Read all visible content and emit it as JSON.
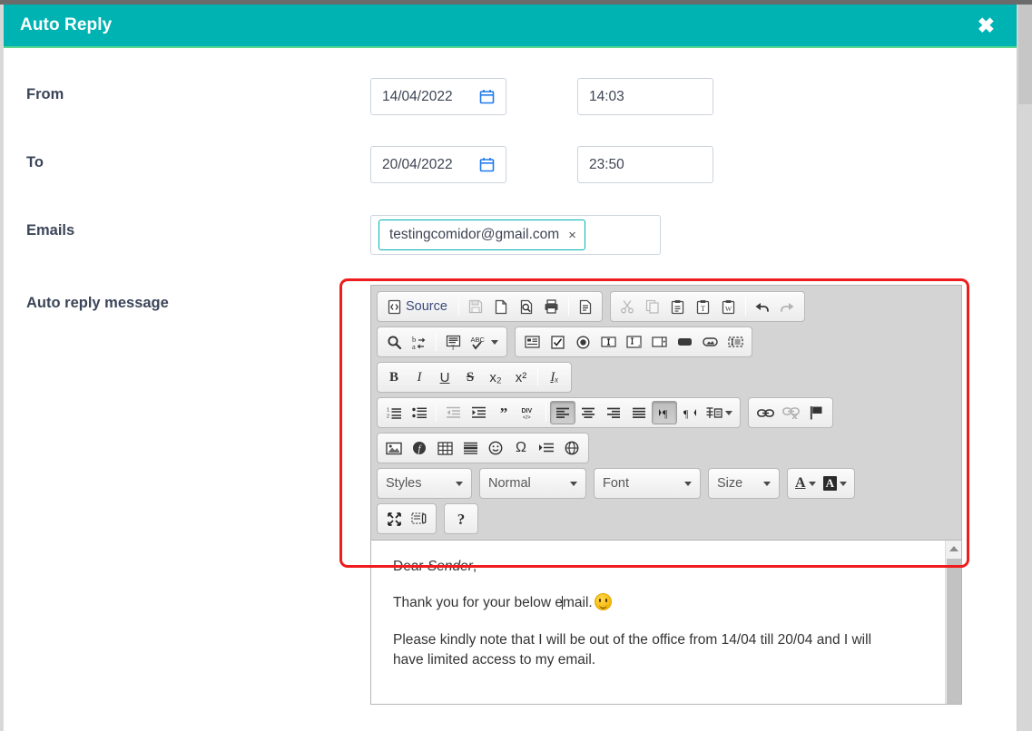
{
  "window": {
    "title": "Auto Reply",
    "close_label": "✖",
    "accent_color": "#00b3b3",
    "highlight_color": "#ee1c1c"
  },
  "form": {
    "rows": [
      {
        "label": "From",
        "date_value": "14/04/2022",
        "date_icon": "calendar-icon",
        "time_value": "14:03"
      },
      {
        "label": "To",
        "date_value": "20/04/2022",
        "date_icon": "calendar-icon",
        "time_value": "23:50"
      }
    ],
    "emails": {
      "label": "Emails",
      "chips": [
        {
          "text": "testingcomidor@gmail.com",
          "remove_label": "×"
        }
      ]
    },
    "message": {
      "label": "Auto reply message"
    }
  },
  "editor": {
    "toolbar": {
      "row1": [
        {
          "name": "source-button",
          "label": "Source",
          "icon": "source-icon",
          "state": "normal"
        },
        {
          "name": "separator",
          "icon": "separator",
          "state": "normal"
        },
        {
          "name": "save-button",
          "icon": "save-icon",
          "state": "disabled"
        },
        {
          "name": "new-page-button",
          "icon": "new-page-icon",
          "state": "normal"
        },
        {
          "name": "preview-button",
          "icon": "preview-icon",
          "state": "normal"
        },
        {
          "name": "print-button",
          "icon": "print-icon",
          "state": "normal"
        },
        {
          "name": "separator",
          "icon": "separator",
          "state": "normal"
        },
        {
          "name": "templates-button",
          "icon": "templates-icon",
          "state": "normal"
        }
      ],
      "row1b": [
        {
          "name": "cut-button",
          "icon": "scissors-icon",
          "state": "disabled"
        },
        {
          "name": "copy-button",
          "icon": "copy-icon",
          "state": "disabled"
        },
        {
          "name": "paste-button",
          "icon": "paste-icon",
          "state": "normal"
        },
        {
          "name": "paste-text-button",
          "icon": "paste-text-icon",
          "state": "normal"
        },
        {
          "name": "paste-word-button",
          "icon": "paste-word-icon",
          "state": "normal"
        },
        {
          "name": "separator",
          "icon": "separator",
          "state": "normal"
        },
        {
          "name": "undo-button",
          "icon": "undo-arrow-icon",
          "state": "normal"
        },
        {
          "name": "redo-button",
          "icon": "redo-arrow-icon",
          "state": "disabled"
        }
      ],
      "row2": [
        {
          "name": "find-button",
          "icon": "magnifier-icon",
          "state": "normal"
        },
        {
          "name": "replace-button",
          "icon": "replace-icon",
          "state": "normal"
        },
        {
          "name": "separator",
          "icon": "separator",
          "state": "normal"
        },
        {
          "name": "select-all-button",
          "icon": "select-all-icon",
          "state": "normal"
        },
        {
          "name": "spellcheck-button",
          "icon": "abc-check-icon",
          "state": "normal",
          "has_caret": true
        }
      ],
      "row2b": [
        {
          "name": "form-button",
          "icon": "form-icon",
          "state": "normal"
        },
        {
          "name": "checkbox-button",
          "icon": "checkbox-icon",
          "state": "normal"
        },
        {
          "name": "radio-button",
          "icon": "radio-icon",
          "state": "normal"
        },
        {
          "name": "text-field-button",
          "icon": "text-field-icon",
          "state": "normal"
        },
        {
          "name": "textarea-button",
          "icon": "textarea-icon",
          "state": "normal"
        },
        {
          "name": "select-field-button",
          "icon": "select-field-icon",
          "state": "normal"
        },
        {
          "name": "button-field-button",
          "icon": "button-field-icon",
          "state": "normal"
        },
        {
          "name": "image-button-button",
          "icon": "image-button-icon",
          "state": "normal"
        },
        {
          "name": "hidden-field-button",
          "icon": "hidden-field-icon",
          "state": "normal"
        }
      ],
      "row3": [
        {
          "name": "bold-button",
          "glyph": "B",
          "style": "b",
          "state": "normal"
        },
        {
          "name": "italic-button",
          "glyph": "I",
          "style": "i",
          "state": "normal"
        },
        {
          "name": "underline-button",
          "glyph": "U",
          "style": "u",
          "state": "normal"
        },
        {
          "name": "strikethrough-button",
          "glyph": "S",
          "style": "s",
          "state": "normal"
        },
        {
          "name": "subscript-button",
          "glyph": "x₂",
          "style": "",
          "state": "normal"
        },
        {
          "name": "superscript-button",
          "glyph": "x²",
          "style": "",
          "state": "normal"
        },
        {
          "name": "separator",
          "icon": "separator",
          "state": "normal"
        },
        {
          "name": "remove-format-button",
          "glyph": "Iₓ",
          "style": "i",
          "state": "normal"
        }
      ],
      "row4": [
        {
          "name": "numbered-list-button",
          "icon": "numbered-list-icon",
          "state": "normal"
        },
        {
          "name": "bulleted-list-button",
          "icon": "bulleted-list-icon",
          "state": "normal"
        },
        {
          "name": "separator",
          "icon": "separator",
          "state": "normal"
        },
        {
          "name": "outdent-button",
          "icon": "outdent-icon",
          "state": "disabled"
        },
        {
          "name": "indent-button",
          "icon": "indent-icon",
          "state": "normal"
        },
        {
          "name": "blockquote-button",
          "icon": "quote-icon",
          "state": "normal"
        },
        {
          "name": "create-div-button",
          "icon": "div-icon",
          "state": "normal"
        },
        {
          "name": "separator",
          "icon": "separator",
          "state": "normal"
        },
        {
          "name": "align-left-button",
          "icon": "align-left-icon",
          "state": "active"
        },
        {
          "name": "align-center-button",
          "icon": "align-center-icon",
          "state": "normal"
        },
        {
          "name": "align-right-button",
          "icon": "align-right-icon",
          "state": "normal"
        },
        {
          "name": "align-justify-button",
          "icon": "align-justify-icon",
          "state": "normal"
        },
        {
          "name": "text-direction-ltr-button",
          "icon": "ltr-icon",
          "state": "active"
        },
        {
          "name": "text-direction-rtl-button",
          "icon": "rtl-icon",
          "state": "normal"
        },
        {
          "name": "language-button",
          "icon": "language-icon",
          "state": "normal",
          "has_caret": true
        }
      ],
      "row4b": [
        {
          "name": "link-button",
          "icon": "link-icon",
          "state": "normal"
        },
        {
          "name": "unlink-button",
          "icon": "unlink-icon",
          "state": "disabled"
        },
        {
          "name": "anchor-button",
          "icon": "flag-icon",
          "state": "normal"
        }
      ],
      "row5": [
        {
          "name": "image-button",
          "icon": "image-icon",
          "state": "normal"
        },
        {
          "name": "flash-button",
          "icon": "flash-icon",
          "state": "normal"
        },
        {
          "name": "table-button",
          "icon": "table-icon",
          "state": "normal"
        },
        {
          "name": "horizontal-rule-button",
          "icon": "horizontal-rule-icon",
          "state": "normal"
        },
        {
          "name": "smiley-button",
          "icon": "smiley-icon",
          "state": "normal"
        },
        {
          "name": "special-char-button",
          "icon": "omega-icon",
          "state": "normal"
        },
        {
          "name": "page-break-button",
          "icon": "page-break-icon",
          "state": "normal"
        },
        {
          "name": "iframe-button",
          "icon": "globe-icon",
          "state": "normal"
        }
      ],
      "combos": [
        {
          "name": "styles-combo",
          "label": "Styles"
        },
        {
          "name": "paragraph-format-combo",
          "label": "Normal"
        },
        {
          "name": "font-combo",
          "label": "Font"
        },
        {
          "name": "font-size-combo",
          "label": "Size"
        }
      ],
      "color_buttons": [
        {
          "name": "text-color-button",
          "glyph": "A",
          "kind": "text-color"
        },
        {
          "name": "background-color-button",
          "glyph": "A",
          "kind": "bg-color"
        }
      ],
      "row7": [
        {
          "name": "maximize-button",
          "icon": "maximize-icon",
          "state": "normal"
        },
        {
          "name": "show-blocks-button",
          "icon": "show-blocks-icon",
          "state": "normal"
        }
      ],
      "row7b": [
        {
          "name": "about-button",
          "glyph": "?",
          "style": "",
          "state": "normal"
        }
      ]
    },
    "content": {
      "paragraph1_prefix": "Dear ",
      "paragraph1_italic": "Sender",
      "paragraph1_suffix": ",",
      "paragraph2_before_caret": "Thank you for your below e",
      "paragraph2_after_caret": "mail.",
      "paragraph2_emoji": "slightly-smiling-face",
      "paragraph3": "Please kindly note that I will be out of the office from 14/04 till 20/04 and I will have limited access to my email."
    },
    "scrollbar": {
      "up_arrow": "scroll-up-arrow"
    }
  }
}
